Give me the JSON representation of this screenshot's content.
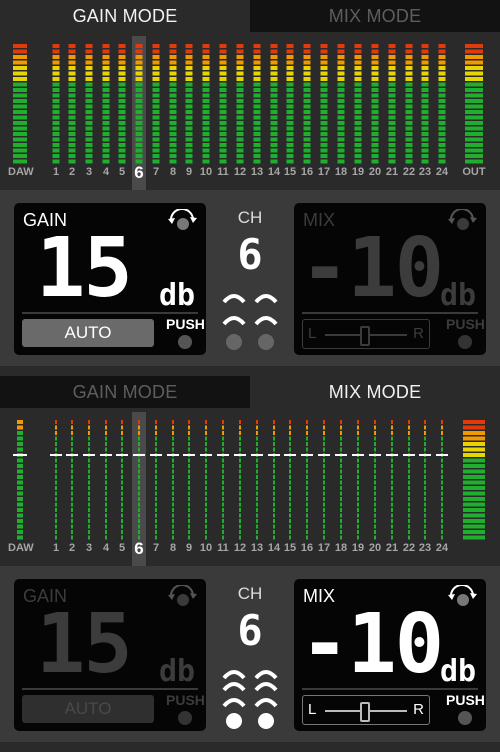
{
  "panels": [
    {
      "tabs": {
        "left": "GAIN MODE",
        "right": "MIX MODE"
      },
      "active": "gain",
      "channel_labels": [
        "DAW",
        "1",
        "2",
        "3",
        "4",
        "5",
        "6",
        "7",
        "8",
        "9",
        "10",
        "11",
        "12",
        "13",
        "14",
        "15",
        "16",
        "17",
        "18",
        "19",
        "20",
        "21",
        "22",
        "23",
        "24",
        "OUT"
      ],
      "selected_channel": "6",
      "gain_box": {
        "title": "GAIN",
        "value": "15",
        "unit": "db",
        "auto_label": "AUTO",
        "push_label": "PUSH"
      },
      "ch_box": {
        "label": "CH",
        "value": "6"
      },
      "mix_box": {
        "title": "MIX",
        "value": "-10",
        "unit": "db",
        "left_label": "L",
        "right_label": "R",
        "push_label": "PUSH",
        "pan": 0.5
      }
    },
    {
      "tabs": {
        "left": "GAIN MODE",
        "right": "MIX MODE"
      },
      "active": "mix",
      "channel_labels": [
        "DAW",
        "1",
        "2",
        "3",
        "4",
        "5",
        "6",
        "7",
        "8",
        "9",
        "10",
        "11",
        "12",
        "13",
        "14",
        "15",
        "16",
        "17",
        "18",
        "19",
        "20",
        "21",
        "22",
        "23",
        "24"
      ],
      "selected_channel": "6",
      "gain_box": {
        "title": "GAIN",
        "value": "15",
        "unit": "db",
        "auto_label": "AUTO",
        "push_label": "PUSH"
      },
      "ch_box": {
        "label": "CH",
        "value": "6"
      },
      "mix_box": {
        "title": "MIX",
        "value": "-10",
        "unit": "db",
        "left_label": "L",
        "right_label": "R",
        "push_label": "PUSH",
        "pan": 0.5
      }
    }
  ],
  "colors": {
    "green": "#1fae2e",
    "yellow": "#e8d400",
    "orange": "#f09a00",
    "red": "#e23a0a",
    "dim_green": "#0d4a14"
  }
}
